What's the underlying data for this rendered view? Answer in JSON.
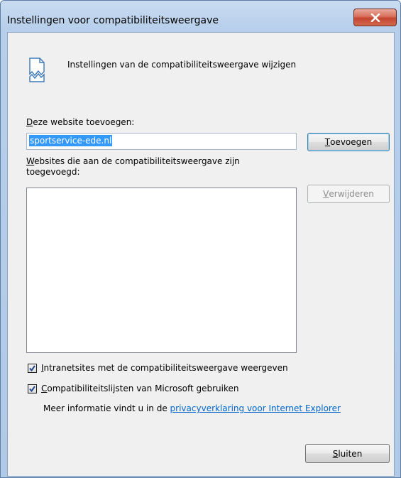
{
  "window": {
    "title": "Instellingen voor compatibiliteitsweergave",
    "close_label": "x"
  },
  "header": {
    "icon": "broken-page-icon",
    "text": "Instellingen van de compatibiliteitsweergave wijzigen"
  },
  "add_section": {
    "label_first": "D",
    "label_rest": "eze website toevoegen:",
    "input_value": "sportservice-ede.nl",
    "add_button_first": "T",
    "add_button_rest": "oevoegen"
  },
  "list_section": {
    "label_line1_first": "W",
    "label_line1_rest": "ebsites die aan de compatibiliteitsweergave zijn",
    "label_line2": "toegevoegd:",
    "items": [],
    "remove_button_first": "V",
    "remove_button_rest": "erwijderen"
  },
  "options": {
    "intranet_first": "I",
    "intranet_rest": "ntranetsites met de compatibiliteitsweergave weergeven",
    "intranet_checked": true,
    "microsoft_first": "C",
    "microsoft_rest": "ompatibiliteitslijsten van Microsoft gebruiken",
    "microsoft_checked": true
  },
  "info": {
    "text": "Meer informatie vindt u in de ",
    "link": "privacyverklaring voor Internet Explorer"
  },
  "footer": {
    "close_first": "S",
    "close_rest": "luiten"
  }
}
